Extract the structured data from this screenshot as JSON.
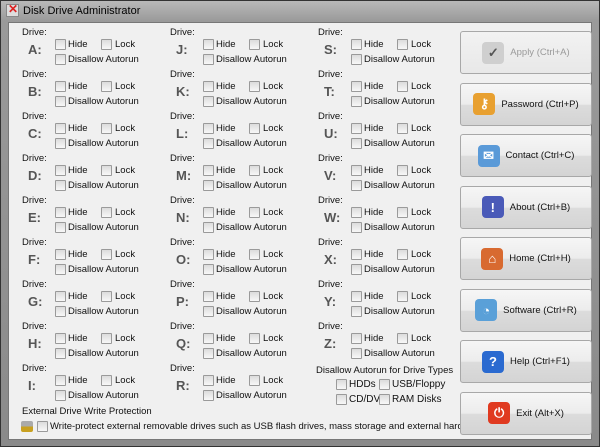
{
  "window": {
    "title": "Disk Drive Administrator"
  },
  "drive_label": "Drive:",
  "hide_label": "Hide",
  "lock_label": "Lock",
  "autorun_label": "Disallow Autorun",
  "drives": [
    [
      "A:",
      "B:",
      "C:",
      "D:",
      "E:",
      "F:",
      "G:",
      "H:",
      "I:"
    ],
    [
      "J:",
      "K:",
      "L:",
      "M:",
      "N:",
      "O:",
      "P:",
      "Q:",
      "R:"
    ],
    [
      "S:",
      "T:",
      "U:",
      "V:",
      "W:",
      "X:",
      "Y:",
      "Z:"
    ]
  ],
  "drive_types": {
    "title": "Disallow Autorun for Drive Types",
    "options": [
      "HDDs",
      "USB/Floppy",
      "CD/DVD",
      "RAM Disks"
    ]
  },
  "write_protection": {
    "title": "External Drive Write Protection",
    "option": "Write-protect external removable drives such as USB flash drives, mass storage and external hard drives"
  },
  "buttons": [
    {
      "label": "Apply (Ctrl+A)",
      "icon": "clipboard-check-icon",
      "disabled": true,
      "color": "#cfcfcf",
      "glyph": "✓"
    },
    {
      "label": "Password (Ctrl+P)",
      "icon": "keys-icon",
      "color": "#e8a030",
      "glyph": "⚷"
    },
    {
      "label": "Contact (Ctrl+C)",
      "icon": "envelope-icon",
      "color": "#5a9ad8",
      "glyph": "✉"
    },
    {
      "label": "About (Ctrl+B)",
      "icon": "info-book-icon",
      "color": "#4a5ab8",
      "glyph": "!"
    },
    {
      "label": "Home (Ctrl+H)",
      "icon": "home-icon",
      "color": "#d86a30",
      "glyph": "⌂"
    },
    {
      "label": "Software (Ctrl+R)",
      "icon": "software-disc-icon",
      "color": "#5aa0d8",
      "glyph": "◔"
    },
    {
      "label": "Help (Ctrl+F1)",
      "icon": "help-icon",
      "color": "#2a6ad0",
      "glyph": "?"
    },
    {
      "label": "Exit (Alt+X)",
      "icon": "power-icon",
      "color": "#e03a20",
      "glyph": "⏻"
    }
  ]
}
